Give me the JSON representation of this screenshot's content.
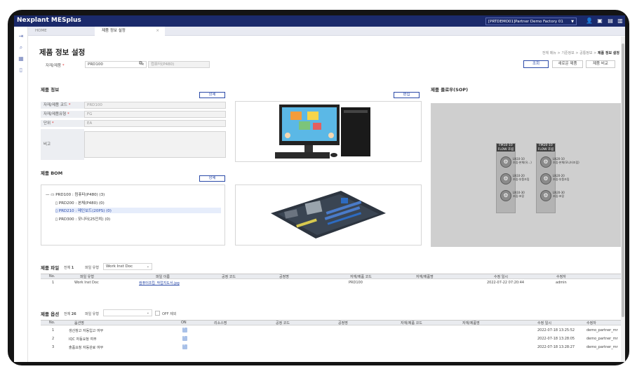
{
  "app": {
    "brand": "Nexplant MESplus",
    "factory": "[PRTDEMO01]Partner Demo Factory 01",
    "icons": [
      "user-icon",
      "chat-icon",
      "monitor-icon",
      "doc-icon"
    ]
  },
  "sidebar": {
    "icons": [
      "collapse-icon",
      "search-icon",
      "grid-icon",
      "bookmark-icon"
    ]
  },
  "tabs": [
    {
      "label": "HOME"
    },
    {
      "label": "제품 정보 설정",
      "close": "×"
    }
  ],
  "page": {
    "title": "제품 정보 설정",
    "breadcrumb": [
      "전체 메뉴",
      "기준정보",
      "공통정보"
    ],
    "breadcrumb_current": "제품 정보 설정",
    "breadcrumb_sep": ">"
  },
  "search": {
    "label": "자재/제품",
    "required": "*",
    "value": "PRD100",
    "clear": "×",
    "name_value": "컴퓨터(P480)",
    "buttons": {
      "search": "조회",
      "new": "새로운 제품",
      "compare": "제품 비교"
    }
  },
  "product_info": {
    "title": "제품 정보",
    "detail_button": "상세",
    "fields": [
      {
        "label": "자재/제품 코드",
        "req": "*",
        "value": "PRD100"
      },
      {
        "label": "자재/제품유형",
        "req": "*",
        "value": "FG"
      },
      {
        "label": "단위",
        "req": "*",
        "value": "EA"
      },
      {
        "label": "비고",
        "req": "",
        "value": ""
      }
    ],
    "edit_button": "편집"
  },
  "bom": {
    "title": "제품 BOM",
    "detail_button": "상세",
    "root": "PRD100 : 컴퓨터(P480) (3)",
    "children": [
      {
        "text": "PRD200 : 본체(P480) (0)",
        "selected": false
      },
      {
        "text": "PRD210 : 메인보드(20PS) (0)",
        "selected": true
      },
      {
        "text": "PRD300 : 모니터(25인치) (0)",
        "selected": false
      }
    ]
  },
  "sop": {
    "title": "제품 플로우(SOP)",
    "flows": [
      {
        "head1": "FM10-10",
        "head2": "FLOW 조립",
        "ops": [
          {
            "code": "LN10-10",
            "name": "조립-본체(유...)"
          },
          {
            "code": "LN10-20",
            "name": "조립-부품조립"
          },
          {
            "code": "LN10-30",
            "name": "조립-포장"
          }
        ]
      },
      {
        "head1": "FM20-10",
        "head2": "FLOW 조립",
        "ops": [
          {
            "code": "LN20-10",
            "name": "조립-본체(모니터조립)"
          },
          {
            "code": "LN20-20",
            "name": "조립-부품조립"
          },
          {
            "code": "LN20-30",
            "name": "조립-포장"
          }
        ]
      }
    ]
  },
  "files": {
    "title": "제품 파일",
    "total_label": "전체",
    "total": "1",
    "type_label": "파일 유형",
    "type_value": "Work Inst Doc",
    "columns": [
      "No.",
      "파일 유형",
      "파일 이름",
      "공정 코드",
      "공정명",
      "자재/제품 코드",
      "자재/제품명",
      "수정 일시",
      "수정자"
    ],
    "rows": [
      [
        "1",
        "Work Inst Doc",
        "컴퓨터조립_작업지도서.jpg",
        "",
        "",
        "PRD100",
        "",
        "2022-07-22 07:20:44",
        "admin"
      ]
    ]
  },
  "options": {
    "title": "제품 옵션",
    "total_label": "전체",
    "total": "26",
    "type_label": "파일 유형",
    "off_label": "OFF 제외",
    "columns": [
      "No.",
      "옵션명",
      "ON",
      "리소스명",
      "공정 코드",
      "공정명",
      "자재/제품 코드",
      "자재/제품명",
      "수정 일시",
      "수정자"
    ],
    "rows": [
      [
        "1",
        "생산창고 자동입고 여부",
        "",
        "",
        "",
        "",
        "",
        "",
        "2022-07-18 13:25:52",
        "demo_partner_mr"
      ],
      [
        "2",
        "IQC 자동요청 여부",
        "",
        "",
        "",
        "",
        "",
        "",
        "2022-07-18 13:28:05",
        "demo_partner_mr"
      ],
      [
        "3",
        "출품요청 자동완료 여부",
        "",
        "",
        "",
        "",
        "",
        "",
        "2022-07-18 13:28:27",
        "demo_partner_mr"
      ]
    ]
  }
}
